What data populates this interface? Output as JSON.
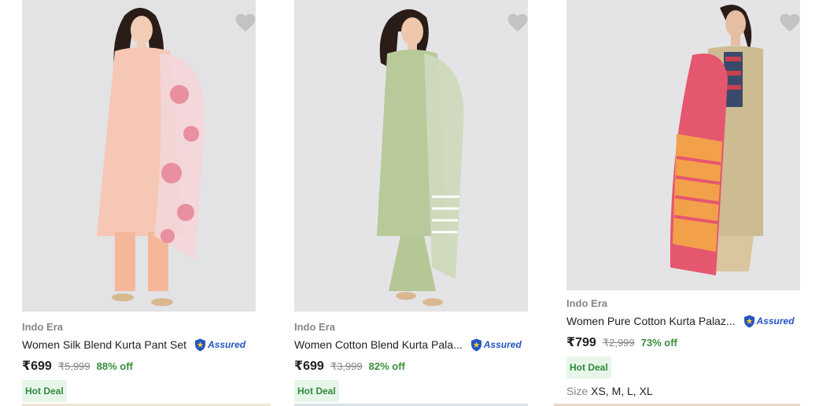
{
  "products": [
    {
      "brand": "Indo Era",
      "title": "Women Silk Blend Kurta Pant Set",
      "assured": "Assured",
      "price": "₹699",
      "mrp": "₹5,999",
      "discount": "88% off",
      "badge": "Hot Deal",
      "colors": {
        "bg": "#e3e2e4",
        "kurta": "#f6c7b4",
        "dupatta": "#f4d6d8",
        "flower": "#e88fa0",
        "pant": "#f4b79a"
      }
    },
    {
      "brand": "Indo Era",
      "title": "Women Cotton Blend Kurta Pala...",
      "assured": "Assured",
      "price": "₹699",
      "mrp": "₹3,999",
      "discount": "82% off",
      "badge": "Hot Deal",
      "colors": {
        "bg": "#e4e4e6",
        "kurta": "#b8c99a",
        "dupatta": "#cfd9bd",
        "flower": "#ffffff",
        "pant": "#b4c795"
      }
    },
    {
      "brand": "Indo Era",
      "title": "Women Pure Cotton Kurta Palaz...",
      "assured": "Assured",
      "price": "₹799",
      "mrp": "₹2,999",
      "discount": "73% off",
      "badge": "Hot Deal",
      "size_label": "Size",
      "sizes": "XS, M, L, XL",
      "colors": {
        "bg": "#e4e4e6",
        "kurta": "#cdbb92",
        "dupatta": "#e5566f",
        "flower": "#f3a04a",
        "pant": "#d9c59e"
      }
    }
  ],
  "theme": {
    "accent_green": "#388e3c",
    "assured_blue": "#2455c3",
    "muted": "#878787"
  }
}
